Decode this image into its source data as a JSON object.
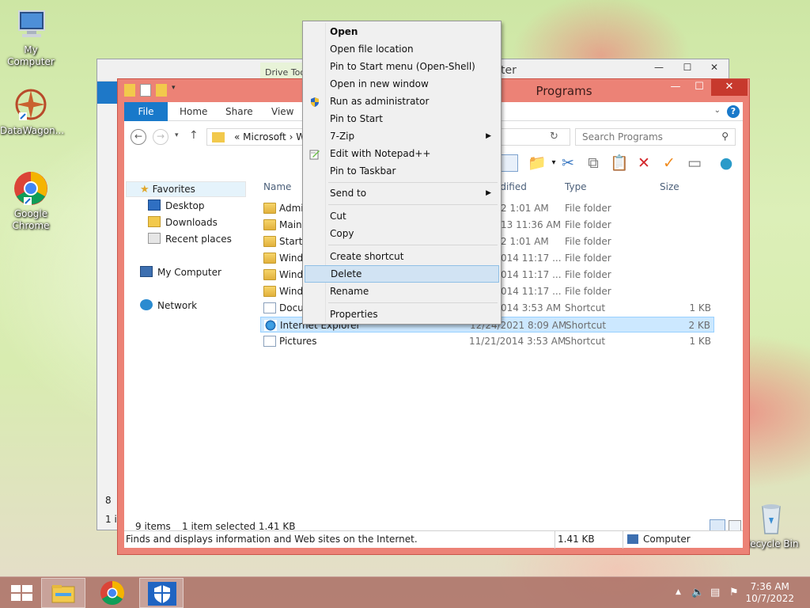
{
  "desktop": {
    "icons": [
      {
        "label": "My Computer"
      },
      {
        "label": "DataWagon..."
      },
      {
        "label": "Google Chrome"
      },
      {
        "label": "Recycle Bin"
      }
    ]
  },
  "back_window": {
    "drive_tools": "Drive Tools",
    "title_fragment": "ter",
    "status_fragment_1": "8",
    "status_fragment_2": "1 it"
  },
  "window": {
    "title": "Programs",
    "tabs": [
      "File",
      "Home",
      "Share",
      "View"
    ],
    "address": {
      "path": "«  Microsoft  ›  W"
    },
    "search_placeholder": "Search Programs",
    "nav": {
      "favorites": "Favorites",
      "desktop": "Desktop",
      "downloads": "Downloads",
      "recent": "Recent places",
      "computer": "My Computer",
      "network": "Network"
    },
    "columns": {
      "name": "Name",
      "modified": "odified",
      "type": "Type",
      "size": "Size"
    },
    "rows": [
      {
        "name": "Admi",
        "modified": "2 1:01 AM",
        "type": "File folder",
        "size": "",
        "icon": "folder"
      },
      {
        "name": "Maint",
        "modified": "13 11:36 AM",
        "type": "File folder",
        "size": "",
        "icon": "folder"
      },
      {
        "name": "Startu",
        "modified": "2 1:01 AM",
        "type": "File folder",
        "size": "",
        "icon": "folder"
      },
      {
        "name": "Wind",
        "modified": "014 11:17 ...",
        "type": "File folder",
        "size": "",
        "icon": "folder"
      },
      {
        "name": "Wind",
        "modified": "014 11:17 ...",
        "type": "File folder",
        "size": "",
        "icon": "folder"
      },
      {
        "name": "Wind",
        "modified": "014 11:17 ...",
        "type": "File folder",
        "size": "",
        "icon": "folder"
      },
      {
        "name": "Docu",
        "modified": "014 3:53 AM",
        "type": "Shortcut",
        "size": "1 KB",
        "icon": "shortcut"
      },
      {
        "name": "Internet Explorer",
        "modified": "12/24/2021 8:09 AM",
        "type": "Shortcut",
        "size": "2 KB",
        "icon": "ie"
      },
      {
        "name": "Pictures",
        "modified": "11/21/2014 3:53 AM",
        "type": "Shortcut",
        "size": "1 KB",
        "icon": "shortcut"
      }
    ],
    "status": {
      "items": "9 items",
      "selected": "1 item selected  1.41 KB"
    },
    "info_bar": {
      "description": "Finds and displays information and Web sites on the Internet.",
      "size": "1.41 KB",
      "location": "Computer"
    }
  },
  "context_menu": {
    "items": [
      {
        "label": "Open"
      },
      {
        "label": "Open file location"
      },
      {
        "label": "Pin to Start menu (Open-Shell)"
      },
      {
        "label": "Open in new window"
      },
      {
        "label": "Run as administrator"
      },
      {
        "label": "Pin to Start"
      },
      {
        "label": "7-Zip"
      },
      {
        "label": "Edit with Notepad++"
      },
      {
        "label": "Pin to Taskbar"
      },
      {
        "label": "Send to"
      },
      {
        "label": "Cut"
      },
      {
        "label": "Copy"
      },
      {
        "label": "Create shortcut"
      },
      {
        "label": "Delete"
      },
      {
        "label": "Rename"
      },
      {
        "label": "Properties"
      }
    ],
    "highlighted": "Delete"
  },
  "taskbar": {
    "time": "7:36 AM",
    "date": "10/7/2022"
  },
  "colors": {
    "window_frame": "#ec8276",
    "accent": "#1979ca",
    "highlight": "#d1e3f3"
  }
}
